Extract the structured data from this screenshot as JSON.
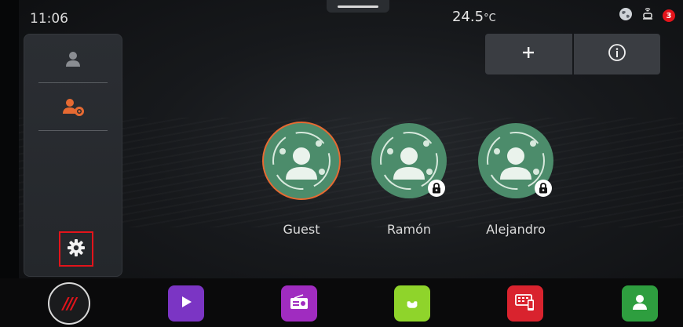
{
  "status_bar": {
    "time": "11:06",
    "temperature": "24.5",
    "temperature_unit": "°C",
    "notification_count": "3",
    "icons": [
      "globe-icon",
      "car-wifi-icon"
    ]
  },
  "side_panel": {
    "items": [
      {
        "icon": "user-icon",
        "active": false
      },
      {
        "icon": "user-settings-icon",
        "active": true
      }
    ],
    "settings_icon": "gear-icon"
  },
  "top_actions": [
    {
      "icon": "plus-icon",
      "label": "+"
    },
    {
      "icon": "info-icon",
      "label": "i"
    }
  ],
  "profiles": [
    {
      "name": "Guest",
      "selected": true,
      "locked": false
    },
    {
      "name": "Ramón",
      "selected": false,
      "locked": true
    },
    {
      "name": "Alejandro",
      "selected": false,
      "locked": true
    }
  ],
  "dock": {
    "home_label": "///",
    "apps": [
      {
        "name": "media-player",
        "icon": "play-icon",
        "color": "#7b35c4"
      },
      {
        "name": "radio",
        "icon": "radio-icon",
        "color": "#a02cc0"
      },
      {
        "name": "phone",
        "icon": "phone-icon",
        "color": "#8fd42b"
      },
      {
        "name": "phone-projection",
        "icon": "phone-projection-icon",
        "color": "#d9232e"
      },
      {
        "name": "contacts",
        "icon": "contact-icon",
        "color": "#2e9e3f"
      }
    ]
  },
  "colors": {
    "accent": "#e66a32",
    "alert": "#e3141b",
    "avatar": "#4c8c6b"
  }
}
